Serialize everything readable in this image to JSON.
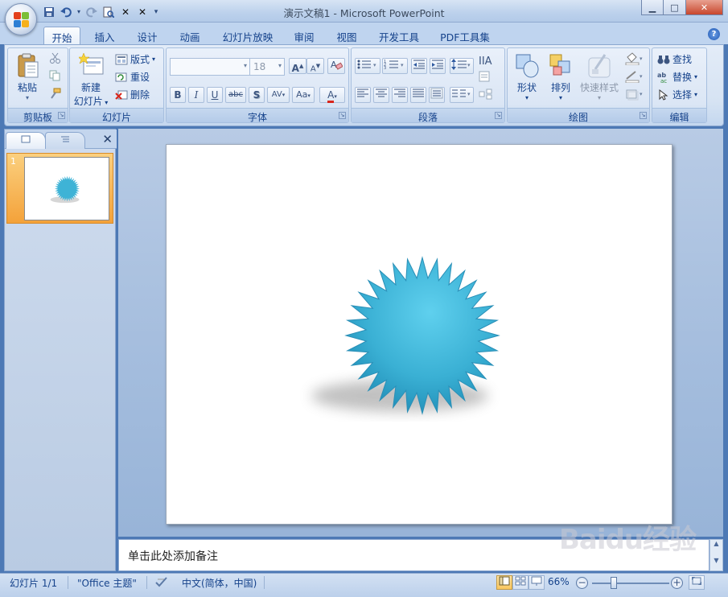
{
  "window": {
    "title": "演示文稿1 - Microsoft PowerPoint",
    "minimize": "▁",
    "maximize": "□",
    "close": "✕"
  },
  "qat": {
    "items": [
      {
        "name": "save-icon",
        "glyph": "▪"
      },
      {
        "name": "undo-icon",
        "glyph": "↶"
      },
      {
        "name": "undo-dropdown-icon",
        "glyph": "▾"
      },
      {
        "name": "redo-icon",
        "glyph": "↷"
      },
      {
        "name": "print-preview-icon",
        "glyph": "🔍"
      },
      {
        "name": "x-icon-1",
        "glyph": "✕"
      },
      {
        "name": "x-icon-2",
        "glyph": "✕"
      },
      {
        "name": "customize-qat-icon",
        "glyph": "▾"
      }
    ]
  },
  "tabs": [
    "开始",
    "插入",
    "设计",
    "动画",
    "幻灯片放映",
    "审阅",
    "视图",
    "开发工具",
    "PDF工具集"
  ],
  "help": "?",
  "ribbon": {
    "clipboard": {
      "label": "剪贴板",
      "paste": "粘贴"
    },
    "slides": {
      "label": "幻灯片",
      "new_slide_line1": "新建",
      "new_slide_line2": "幻灯片",
      "layout": "版式",
      "reset": "重设",
      "delete": "删除"
    },
    "font": {
      "label": "字体",
      "font_name": "",
      "font_size": "18",
      "grow": "A",
      "shrink": "A",
      "bold": "B",
      "italic": "I",
      "underline": "U",
      "strike": "abc",
      "shadow": "S",
      "spacing": "AV",
      "case": "Aa",
      "color": "A"
    },
    "paragraph": {
      "label": "段落"
    },
    "drawing": {
      "label": "绘图",
      "shapes": "形状",
      "arrange": "排列",
      "quick_styles": "快速样式"
    },
    "editing": {
      "label": "编辑",
      "find": "查找",
      "replace": "替换",
      "select": "选择"
    }
  },
  "slides_pane": {
    "slide_number": "1"
  },
  "notes": {
    "placeholder": "单击此处添加备注"
  },
  "status": {
    "slide": "幻灯片 1/1",
    "theme": "\"Office 主题\"",
    "language": "中文(简体，中国)",
    "zoom": "66%"
  },
  "colors": {
    "starburst": "#3eb3d6",
    "accent": "#15428b"
  }
}
